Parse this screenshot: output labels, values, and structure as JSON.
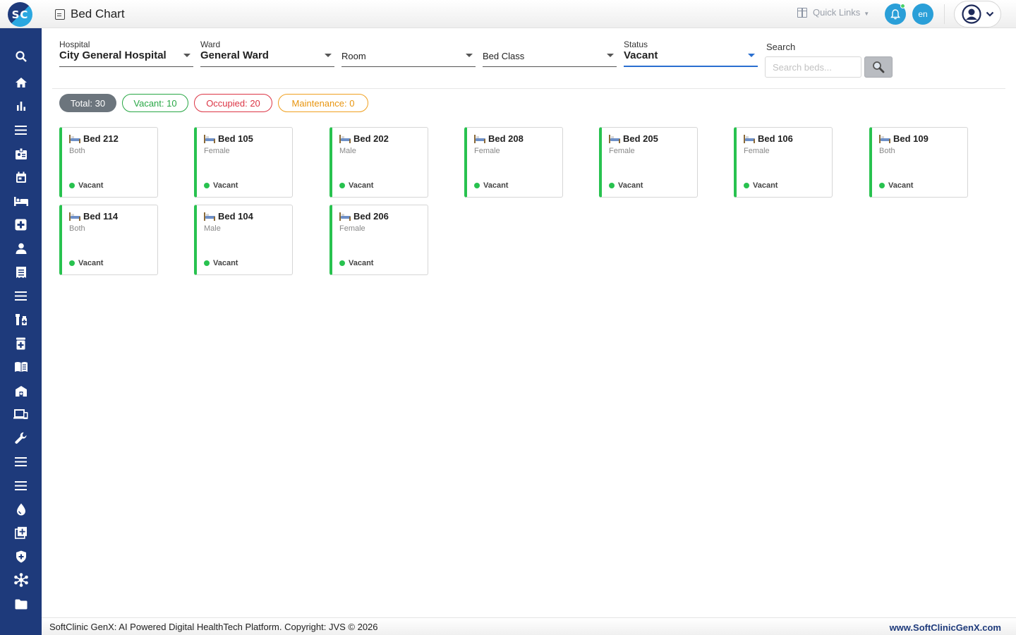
{
  "app": {
    "logo_text": "SC",
    "page_title": "Bed Chart"
  },
  "header": {
    "quick_links_label": "Quick Links",
    "lang_label": "en"
  },
  "sidebar": {
    "items": [
      {
        "name": "search"
      },
      {
        "name": "home"
      },
      {
        "name": "dashboard"
      },
      {
        "name": "menu"
      },
      {
        "name": "badge"
      },
      {
        "name": "calendar"
      },
      {
        "name": "bed"
      },
      {
        "name": "medical"
      },
      {
        "name": "person"
      },
      {
        "name": "receipt"
      },
      {
        "name": "list"
      },
      {
        "name": "pharmacy"
      },
      {
        "name": "medicine"
      },
      {
        "name": "book"
      },
      {
        "name": "store"
      },
      {
        "name": "devices"
      },
      {
        "name": "tools"
      },
      {
        "name": "menu-2"
      },
      {
        "name": "menu-3"
      },
      {
        "name": "blood"
      },
      {
        "name": "add-box"
      },
      {
        "name": "shield"
      },
      {
        "name": "network"
      },
      {
        "name": "folder"
      }
    ]
  },
  "filters": {
    "hospital": {
      "label": "Hospital",
      "value": "City General Hospital"
    },
    "ward": {
      "label": "Ward",
      "value": "General Ward"
    },
    "room": {
      "placeholder": "Room"
    },
    "bed_class": {
      "placeholder": "Bed Class"
    },
    "status": {
      "label": "Status",
      "value": "Vacant"
    },
    "search": {
      "label": "Search",
      "placeholder": "Search beds..."
    }
  },
  "summary": {
    "total": "Total: 30",
    "vacant": "Vacant: 10",
    "occupied": "Occupied: 20",
    "maintenance": "Maintenance: 0"
  },
  "beds": [
    {
      "name": "Bed 212",
      "gender": "Both",
      "status": "Vacant"
    },
    {
      "name": "Bed 105",
      "gender": "Female",
      "status": "Vacant"
    },
    {
      "name": "Bed 202",
      "gender": "Male",
      "status": "Vacant"
    },
    {
      "name": "Bed 208",
      "gender": "Female",
      "status": "Vacant"
    },
    {
      "name": "Bed 205",
      "gender": "Female",
      "status": "Vacant"
    },
    {
      "name": "Bed 106",
      "gender": "Female",
      "status": "Vacant"
    },
    {
      "name": "Bed 109",
      "gender": "Both",
      "status": "Vacant"
    },
    {
      "name": "Bed 114",
      "gender": "Both",
      "status": "Vacant"
    },
    {
      "name": "Bed 104",
      "gender": "Male",
      "status": "Vacant"
    },
    {
      "name": "Bed 206",
      "gender": "Female",
      "status": "Vacant"
    }
  ],
  "footer": {
    "copyright": "SoftClinic GenX: AI Powered Digital HealthTech Platform. Copyright: JVS © 2026",
    "website": "www.SoftClinicGenX.com"
  },
  "colors": {
    "sidebar": "#1e3a7b",
    "accent": "#2a9fd8",
    "vacant": "#28a745",
    "occupied": "#dc3545",
    "maintenance": "#f0a020"
  }
}
